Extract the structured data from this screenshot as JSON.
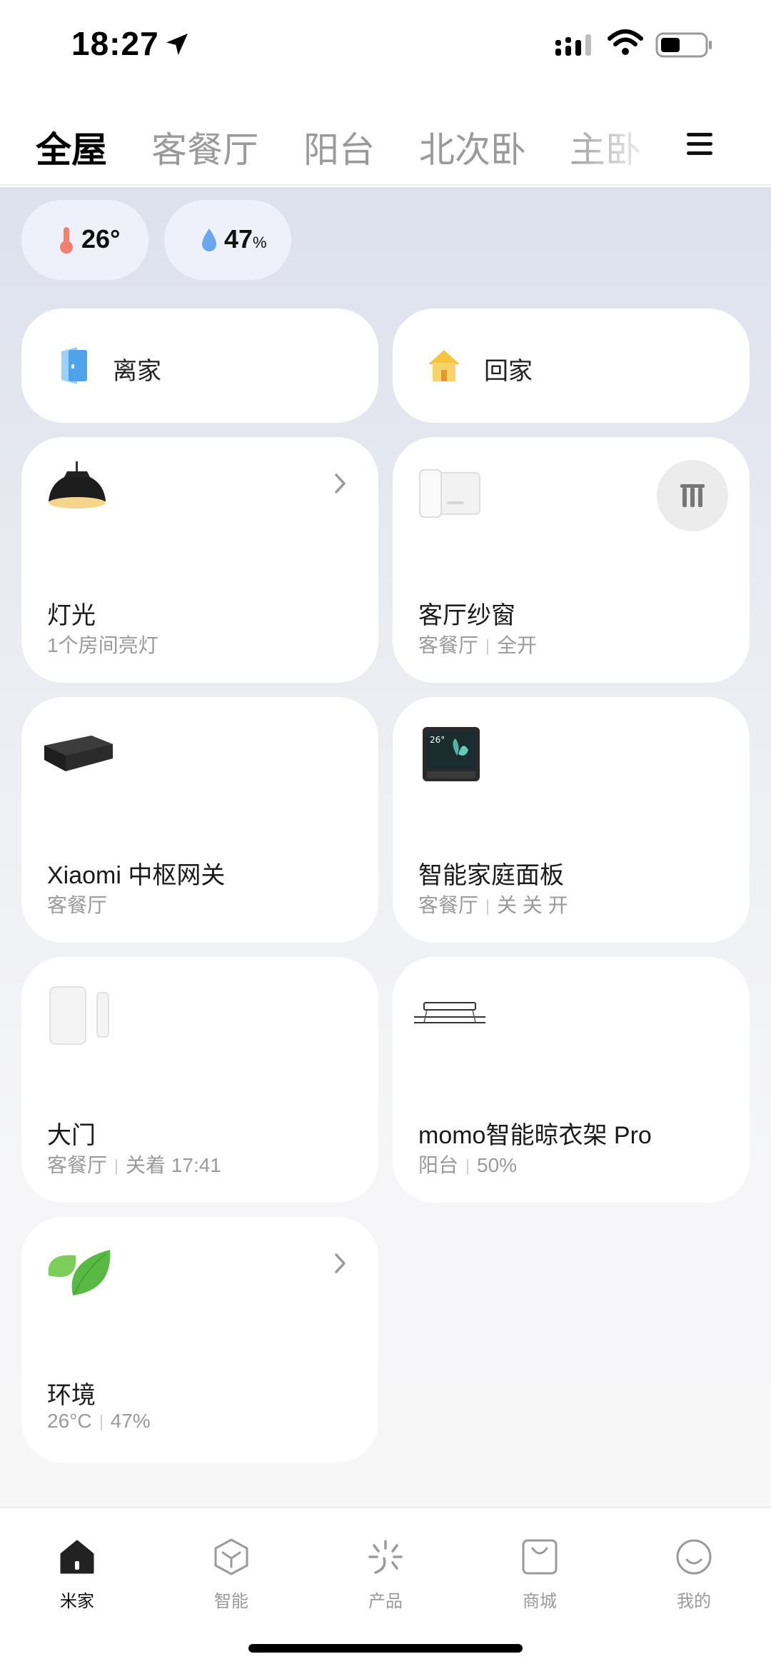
{
  "status_bar": {
    "time": "18:27",
    "icons": [
      "location-arrow-icon",
      "signal-icon",
      "wifi-icon",
      "battery-icon"
    ]
  },
  "tabs": [
    {
      "label": "全屋",
      "active": true
    },
    {
      "label": "客餐厅",
      "active": false
    },
    {
      "label": "阳台",
      "active": false
    },
    {
      "label": "北次卧",
      "active": false
    },
    {
      "label": "主卧",
      "active": false
    }
  ],
  "climate": {
    "temperature": "26°",
    "humidity": "47",
    "humidity_unit": "%"
  },
  "scenes": [
    {
      "label": "离家",
      "icon": "door-leave-icon"
    },
    {
      "label": "回家",
      "icon": "house-return-icon"
    }
  ],
  "devices": [
    {
      "title": "灯光",
      "sub": "1个房间亮灯",
      "sub2": "",
      "icon": "pendant-lamp-icon"
    },
    {
      "title": "客厅纱窗",
      "sub": "客餐厅",
      "sub2": "全开",
      "icon": "window-screen-device-icon"
    },
    {
      "title": "Xiaomi 中枢网关",
      "sub": "客餐厅",
      "sub2": "",
      "icon": "gateway-box-icon"
    },
    {
      "title": "智能家庭面板",
      "sub": "客餐厅",
      "sub2": "关 关 开",
      "icon": "smart-panel-icon",
      "panel_temp": "26°"
    },
    {
      "title": "大门",
      "sub": "客餐厅",
      "sub2": "关着 17:41",
      "icon": "door-sensor-icon"
    },
    {
      "title": "momo智能晾衣架 Pro",
      "sub": "阳台",
      "sub2": "50%",
      "icon": "clothes-rack-icon"
    },
    {
      "title": "环境",
      "sub": "26°C",
      "sub2": "47%",
      "icon": "leaf-icon"
    }
  ],
  "bottom_nav": [
    {
      "label": "米家",
      "icon": "home-icon",
      "active": true
    },
    {
      "label": "智能",
      "icon": "cube-icon",
      "active": false
    },
    {
      "label": "产品",
      "icon": "sparkle-icon",
      "active": false
    },
    {
      "label": "商城",
      "icon": "shopping-bag-icon",
      "active": false
    },
    {
      "label": "我的",
      "icon": "smiley-icon",
      "active": false
    }
  ],
  "colors": {
    "accent": "#000000",
    "inactive": "#9a9a9a",
    "background_top": "#dde1ec",
    "card": "#ffffff",
    "scene_home": "#f5c542",
    "scene_leave": "#5aa6f0"
  }
}
